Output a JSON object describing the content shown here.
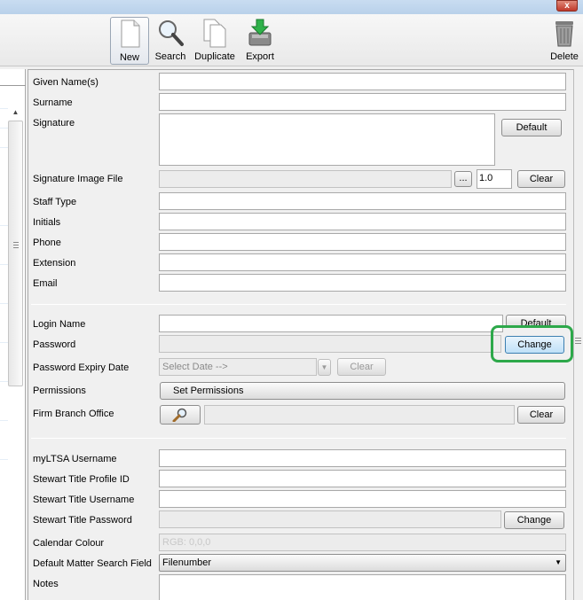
{
  "titlebar": {
    "close": "x"
  },
  "toolbar": {
    "new": "New",
    "search": "Search",
    "duplicate": "Duplicate",
    "export": "Export",
    "delete": "Delete"
  },
  "form": {
    "given_names": "Given Name(s)",
    "surname": "Surname",
    "signature": "Signature",
    "signature_default": "Default",
    "signature_image_file": "Signature Image File",
    "browse": "...",
    "scale_value": "1.0",
    "clear_signature": "Clear",
    "staff_type": "Staff Type",
    "initials": "Initials",
    "phone": "Phone",
    "extension": "Extension",
    "email": "Email",
    "login_name": "Login Name",
    "login_default": "Default",
    "password": "Password",
    "password_change": "Change",
    "password_expiry_date": "Password Expiry Date",
    "expiry_placeholder": "Select Date -->",
    "expiry_clear": "Clear",
    "permissions": "Permissions",
    "set_permissions": "Set Permissions",
    "firm_branch_office": "Firm Branch Office",
    "branch_clear": "Clear",
    "myltsa_username": "myLTSA Username",
    "stewart_profile_id": "Stewart Title Profile ID",
    "stewart_username": "Stewart Title Username",
    "stewart_password": "Stewart Title Password",
    "stewart_change": "Change",
    "calendar_colour": "Calendar Colour",
    "calendar_value": "RGB: 0,0,0",
    "default_matter_search_field": "Default Matter Search Field",
    "default_matter_value": "Filenumber",
    "notes": "Notes"
  }
}
